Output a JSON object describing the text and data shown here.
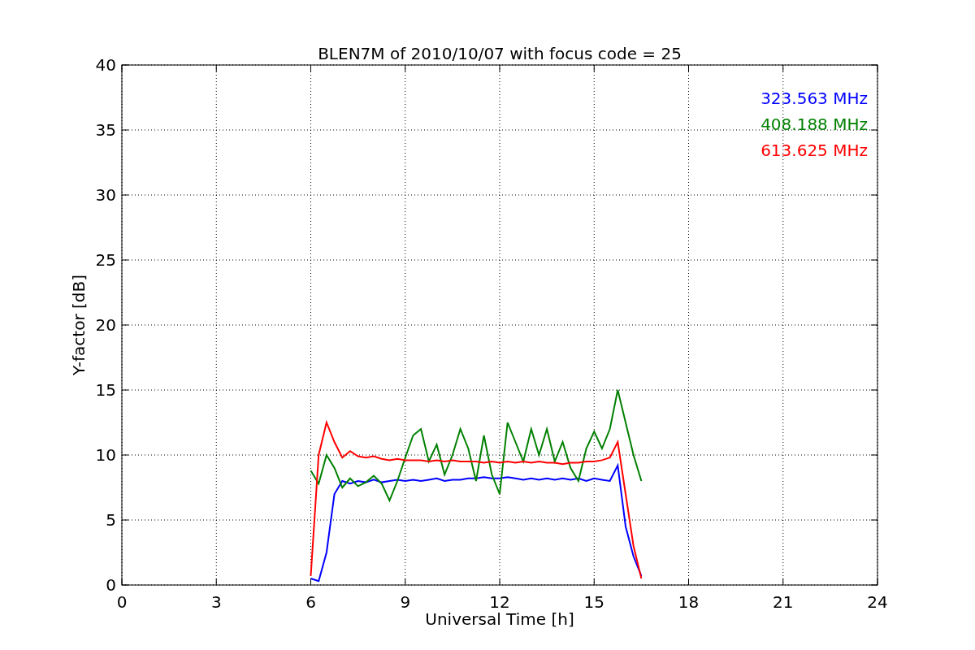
{
  "chart_data": {
    "type": "line",
    "title": "BLEN7M of 2010/10/07 with focus code = 25",
    "xlabel": "Universal Time [h]",
    "ylabel": "Y-factor [dB]",
    "x": [
      6,
      6.25,
      6.5,
      6.75,
      7,
      7.25,
      7.5,
      7.75,
      8,
      8.25,
      8.5,
      8.75,
      9,
      9.25,
      9.5,
      9.75,
      10,
      10.25,
      10.5,
      10.75,
      11,
      11.25,
      11.5,
      11.75,
      12,
      12.25,
      12.5,
      12.75,
      13,
      13.25,
      13.5,
      13.75,
      14,
      14.25,
      14.5,
      14.75,
      15,
      15.25,
      15.5,
      15.75,
      16,
      16.25,
      16.5
    ],
    "series": [
      {
        "name": "323.563 MHz",
        "color": "#0000ff",
        "values": [
          0.5,
          0.3,
          2.5,
          7,
          8,
          7.8,
          8,
          7.9,
          8.1,
          7.9,
          8,
          8.1,
          8,
          8.1,
          8,
          8.1,
          8.2,
          8,
          8.1,
          8.1,
          8.2,
          8.2,
          8.3,
          8.2,
          8.2,
          8.3,
          8.2,
          8.1,
          8.2,
          8.1,
          8.2,
          8.1,
          8.2,
          8.1,
          8.2,
          8,
          8.2,
          8.1,
          8,
          9.2,
          4.5,
          2.2,
          0.7
        ]
      },
      {
        "name": "408.188 MHz",
        "color": "#008000",
        "values": [
          8.8,
          7.8,
          10,
          9,
          7.5,
          8.2,
          7.6,
          7.9,
          8.4,
          7.8,
          6.5,
          8,
          9.8,
          11.5,
          12,
          9.5,
          10.8,
          8.5,
          10,
          12,
          10.5,
          8,
          11.5,
          8.5,
          7,
          12.5,
          11,
          9.5,
          12,
          10,
          12,
          9.5,
          11,
          9,
          8,
          10.5,
          11.8,
          10.5,
          12,
          15,
          12.5,
          10,
          8
        ]
      },
      {
        "name": "613.625 MHz",
        "color": "#ff0000",
        "values": [
          0.7,
          10,
          12.5,
          11,
          9.8,
          10.3,
          9.9,
          9.8,
          9.9,
          9.7,
          9.6,
          9.7,
          9.6,
          9.6,
          9.6,
          9.5,
          9.6,
          9.5,
          9.6,
          9.5,
          9.5,
          9.5,
          9.4,
          9.5,
          9.4,
          9.5,
          9.4,
          9.5,
          9.4,
          9.5,
          9.4,
          9.4,
          9.3,
          9.4,
          9.4,
          9.5,
          9.5,
          9.6,
          9.8,
          11,
          7,
          3,
          0.5
        ]
      }
    ],
    "grid": true,
    "xlim": [
      0,
      24
    ],
    "ylim": [
      0,
      40
    ],
    "xticks": [
      0,
      3,
      6,
      9,
      12,
      15,
      18,
      21,
      24
    ],
    "yticks": [
      0,
      5,
      10,
      15,
      20,
      25,
      30,
      35,
      40
    ]
  }
}
